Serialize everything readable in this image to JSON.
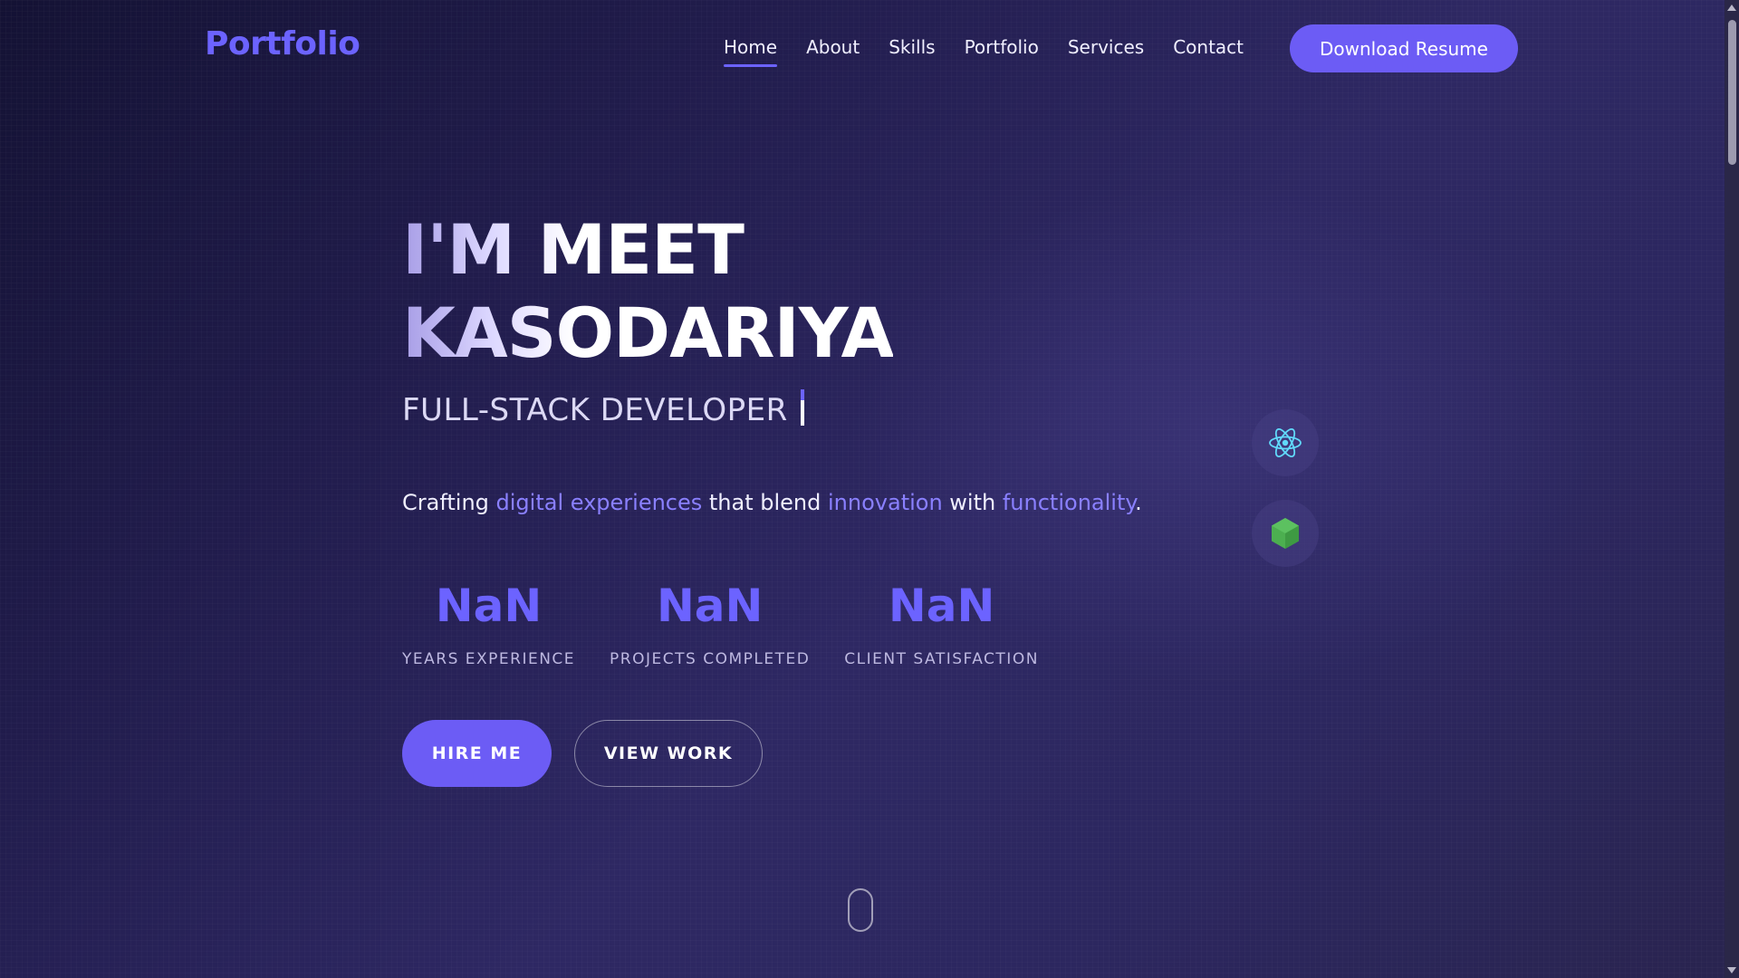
{
  "nav": {
    "logo": "Portfolio",
    "links": [
      "Home",
      "About",
      "Skills",
      "Portfolio",
      "Services",
      "Contact"
    ],
    "active_link": "Home",
    "resume_button": "Download Resume"
  },
  "hero": {
    "title_line1": "I'M MEET",
    "title_line2": "KASODARIYA",
    "subtitle": "FULL-STACK DEVELOPER",
    "tagline": {
      "p1": "Crafting ",
      "h1": "digital experiences",
      "p2": " that blend ",
      "h2": "innovation",
      "p3": " with ",
      "h3": "functionality",
      "p4": "."
    },
    "stats": [
      {
        "value": "NaN",
        "label": "YEARS EXPERIENCE"
      },
      {
        "value": "NaN",
        "label": "PROJECTS COMPLETED"
      },
      {
        "value": "NaN",
        "label": "CLIENT SATISFACTION"
      }
    ],
    "hire_button": "HIRE ME",
    "work_button": "VIEW WORK"
  },
  "tech_icons": [
    "react-icon",
    "nodejs-icon"
  ],
  "colors": {
    "accent": "#6c63ff",
    "button": "#6c5cf5",
    "highlight": "#8a80ff",
    "background_dark": "#141234",
    "background_mid": "#2e2863"
  }
}
